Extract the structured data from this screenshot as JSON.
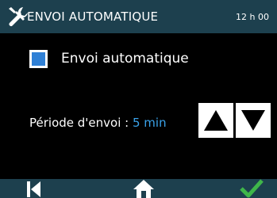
{
  "header": {
    "title": "ENVOI AUTOMATIQUE",
    "clock": "12 h 00",
    "icon": "tools-icon"
  },
  "auto_send": {
    "label": "Envoi automatique",
    "checked": true
  },
  "period": {
    "label": "Période d'envoi :",
    "value": "5 min",
    "increase_icon": "triangle-up-icon",
    "decrease_icon": "triangle-down-icon"
  },
  "footer": {
    "back_icon": "back-icon",
    "home_icon": "home-icon",
    "confirm_icon": "checkmark-icon"
  },
  "colors": {
    "header_bg": "#1d404e",
    "accent_blue": "#3aa3ea",
    "checkbox_fill": "#2f80d6",
    "confirm_green": "#3fb64a"
  }
}
